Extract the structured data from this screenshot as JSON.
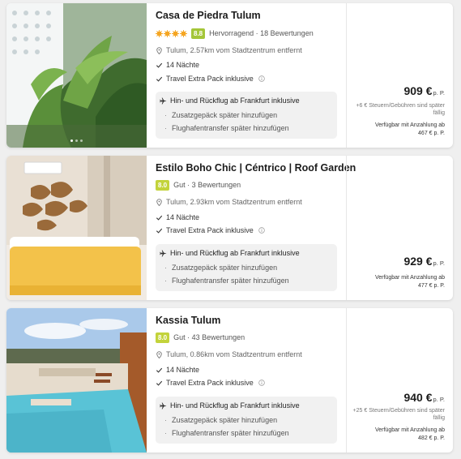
{
  "colors": {
    "accent_star": "#f5a623",
    "badge_green": "#a4c639",
    "badge_gut": "#c3d33b"
  },
  "cards": [
    {
      "title": "Casa de Piedra Tulum",
      "stars": 4,
      "rating": "8.8",
      "rating_text": "Hervorragend · 18 Bewertungen",
      "location": "Tulum, 2.57km vom Stadtzentrum entfernt",
      "nights": "14 Nächte",
      "extra": "Travel Extra Pack inklusive",
      "flight": "Hin- und Rückflug ab Frankfurt inklusive",
      "luggage": "Zusatzgepäck später hinzufügen",
      "transfer": "Flughafentransfer später hinzufügen",
      "price": "909 €",
      "per_person": "p. P.",
      "fee": "+6 € Steuern/Gebühren sind später fällig",
      "deposit_label": "Verfügbar mit Anzahlung ab",
      "deposit_amount": "467 € p. P."
    },
    {
      "title": "Estilo Boho Chic | Céntrico | Roof Garden",
      "rating": "8.0",
      "rating_text": "Gut · 3 Bewertungen",
      "location": "Tulum, 2.93km vom Stadtzentrum entfernt",
      "nights": "14 Nächte",
      "extra": "Travel Extra Pack inklusive",
      "flight": "Hin- und Rückflug ab Frankfurt inklusive",
      "luggage": "Zusatzgepäck später hinzufügen",
      "transfer": "Flughafentransfer später hinzufügen",
      "price": "929 €",
      "per_person": "p. P.",
      "deposit_label": "Verfügbar mit Anzahlung ab",
      "deposit_amount": "477 € p. P."
    },
    {
      "title": "Kassia Tulum",
      "rating": "8.0",
      "rating_text": "Gut · 43 Bewertungen",
      "location": "Tulum, 0.86km vom Stadtzentrum entfernt",
      "nights": "14 Nächte",
      "extra": "Travel Extra Pack inklusive",
      "flight": "Hin- und Rückflug ab Frankfurt inklusive",
      "luggage": "Zusatzgepäck später hinzufügen",
      "transfer": "Flughafentransfer später hinzufügen",
      "price": "940 €",
      "per_person": "p. P.",
      "fee": "+25 € Steuern/Gebühren sind später fällig",
      "deposit_label": "Verfügbar mit Anzahlung ab",
      "deposit_amount": "482 € p. P."
    }
  ]
}
